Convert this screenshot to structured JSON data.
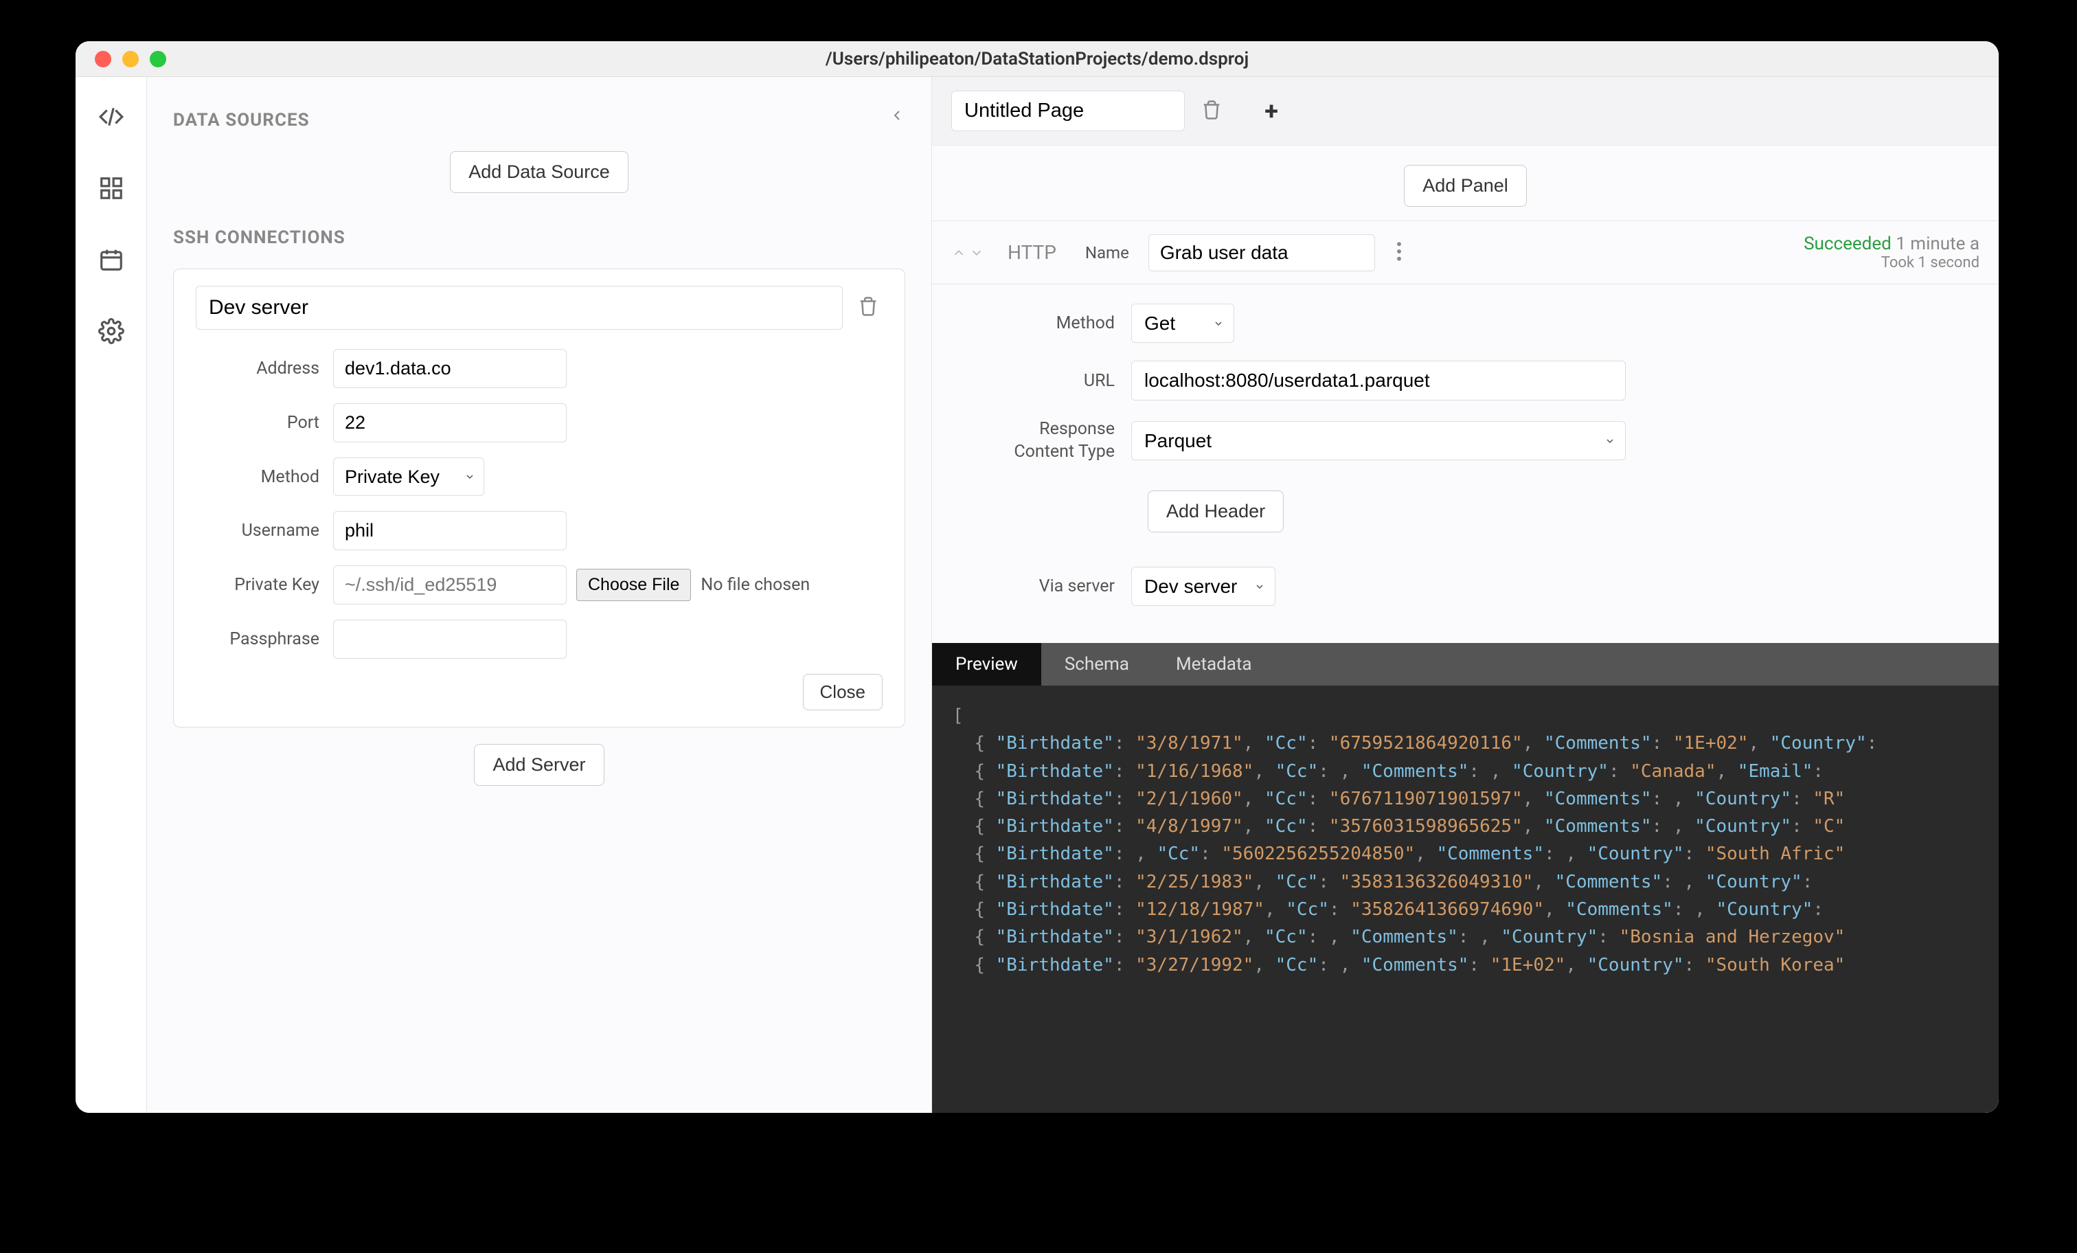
{
  "window": {
    "title": "/Users/philipeaton/DataStationProjects/demo.dsproj"
  },
  "sidebar": {
    "data_sources_title": "DATA SOURCES",
    "add_data_source": "Add Data Source",
    "ssh_title": "SSH CONNECTIONS",
    "add_server": "Add Server",
    "close": "Close",
    "ssh": {
      "name": "Dev server",
      "labels": {
        "address": "Address",
        "port": "Port",
        "method": "Method",
        "username": "Username",
        "private_key": "Private Key",
        "passphrase": "Passphrase"
      },
      "address": "dev1.data.co",
      "port": "22",
      "method": "Private Key",
      "username": "phil",
      "private_key_placeholder": "~/.ssh/id_ed25519",
      "choose_file": "Choose File",
      "no_file": "No file chosen",
      "passphrase": ""
    }
  },
  "page": {
    "name": "Untitled Page",
    "add_panel": "Add Panel"
  },
  "panel": {
    "type": "HTTP",
    "name_label": "Name",
    "name": "Grab user data",
    "status": "Succeeded",
    "status_time": "1 minute a",
    "status_duration": "Took 1 second",
    "labels": {
      "method": "Method",
      "url": "URL",
      "content_type_l1": "Response",
      "content_type_l2": "Content Type",
      "via_server": "Via server"
    },
    "method": "Get",
    "url": "localhost:8080/userdata1.parquet",
    "content_type": "Parquet",
    "add_header": "Add Header",
    "via_server": "Dev server"
  },
  "results": {
    "tabs": {
      "preview": "Preview",
      "schema": "Schema",
      "metadata": "Metadata"
    },
    "rows": [
      {
        "Birthdate": "3/8/1971",
        "Cc": "6759521864920116",
        "Comments": "1E+02",
        "Country": ""
      },
      {
        "Birthdate": "1/16/1968",
        "Cc": "",
        "Comments": "",
        "Country": "Canada",
        "Email": ""
      },
      {
        "Birthdate": "2/1/1960",
        "Cc": "6767119071901597",
        "Comments": "",
        "Country": "R"
      },
      {
        "Birthdate": "4/8/1997",
        "Cc": "3576031598965625",
        "Comments": "",
        "Country": "C"
      },
      {
        "Birthdate": "",
        "Cc": "5602256255204850",
        "Comments": "",
        "Country": "South Afric"
      },
      {
        "Birthdate": "2/25/1983",
        "Cc": "3583136326049310",
        "Comments": "",
        "Country": ""
      },
      {
        "Birthdate": "12/18/1987",
        "Cc": "3582641366974690",
        "Comments": "",
        "Country": ""
      },
      {
        "Birthdate": "3/1/1962",
        "Cc": "",
        "Comments": "",
        "Country": "Bosnia and Herzegov"
      },
      {
        "Birthdate": "3/27/1992",
        "Cc": "",
        "Comments": "1E+02",
        "Country": "South Korea"
      }
    ]
  }
}
